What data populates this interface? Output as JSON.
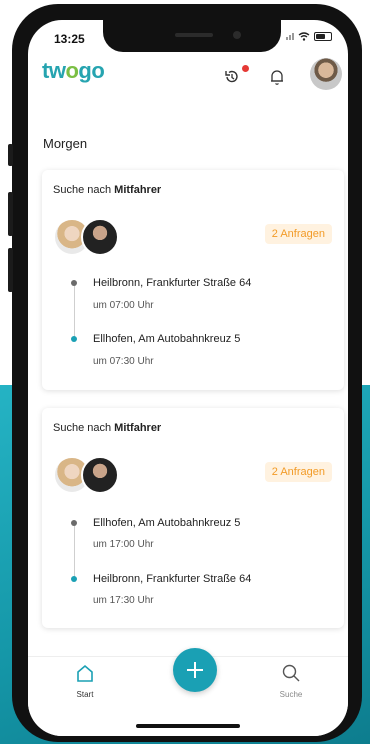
{
  "status_bar": {
    "time": "13:25"
  },
  "header": {
    "logo": {
      "part1": "tw",
      "part2": "o",
      "part3": "go"
    },
    "icons": [
      "history-icon",
      "bell-icon",
      "profile-avatar"
    ]
  },
  "section": {
    "title": "Morgen"
  },
  "rides": [
    {
      "heading_prefix": "Suche nach ",
      "heading_strong": "Mitfahrer",
      "requests": "2 Anfragen",
      "stops": [
        {
          "name": "Heilbronn, Frankfurter Straße 64",
          "time": "um 07:00 Uhr"
        },
        {
          "name": "Ellhofen, Am Autobahnkreuz 5",
          "time": "um 07:30 Uhr"
        }
      ]
    },
    {
      "heading_prefix": "Suche nach ",
      "heading_strong": "Mitfahrer",
      "requests": "2 Anfragen",
      "stops": [
        {
          "name": "Ellhofen, Am Autobahnkreuz 5",
          "time": "um 17:00 Uhr"
        },
        {
          "name": "Heilbronn, Frankfurter Straße 64",
          "time": "um 17:30 Uhr"
        }
      ]
    }
  ],
  "tabbar": {
    "start": "Start",
    "search": "Suche"
  },
  "colors": {
    "teal": "#1aa0b4",
    "green": "#7bbf44",
    "badge_text": "#f29b27",
    "badge_bg": "#fff2e0"
  }
}
